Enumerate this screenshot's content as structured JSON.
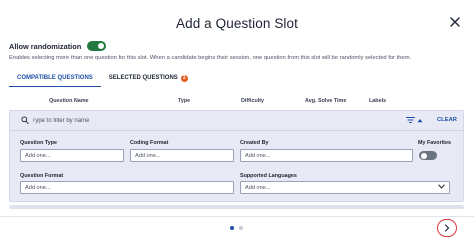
{
  "dialog": {
    "title": "Add a Question Slot"
  },
  "randomization": {
    "label": "Allow randomization",
    "enabled": true,
    "description": "Enables selecting more than one question for this slot. When a candidate begins their session, one question from this slot will be randomly selected for them."
  },
  "tabs": [
    {
      "label": "COMPATIBLE QUESTIONS",
      "active": true
    },
    {
      "label": "SELECTED QUESTIONS",
      "active": false,
      "badge": "2"
    }
  ],
  "table": {
    "columns": [
      "Question Name",
      "Type",
      "Difficulty",
      "Avg. Solve Time",
      "Labels"
    ]
  },
  "filters": {
    "search_placeholder": "Type to filter by name",
    "clear_label": "CLEAR",
    "question_type": {
      "label": "Question Type",
      "placeholder": "Add one..."
    },
    "coding_format": {
      "label": "Coding Format",
      "placeholder": "Add one..."
    },
    "created_by": {
      "label": "Created By",
      "placeholder": "Add one..."
    },
    "my_favorites": {
      "label": "My Favorites",
      "enabled": false
    },
    "question_format": {
      "label": "Question Format",
      "placeholder": "Add one..."
    },
    "supported_languages": {
      "label": "Supported Languages",
      "placeholder": "Add one..."
    }
  },
  "pagination": {
    "pages": 2,
    "current": 1
  },
  "colors": {
    "accent": "#1e4fa8",
    "toggle_on": "#22783f",
    "badge": "#e25a1c",
    "panel_bg": "#e7eaf5",
    "highlight": "#d9363e"
  },
  "icons": {
    "close": "close-icon",
    "search": "search-icon",
    "filter": "filter-icon",
    "caret": "caret-up-icon",
    "dropdown": "chevron-down-icon",
    "next": "chevron-right-icon"
  }
}
